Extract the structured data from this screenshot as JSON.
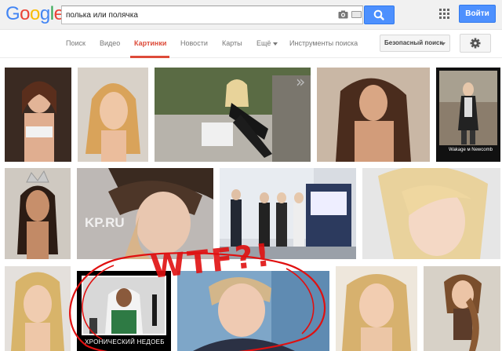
{
  "header": {
    "logo_text": "Google",
    "logo_colors": [
      "#4285f4",
      "#ea4335",
      "#fbbc05",
      "#4285f4",
      "#34a853",
      "#ea4335"
    ],
    "search_value": "полька или полячка",
    "search_button_icon": "search-icon",
    "apps_icon": "apps-grid-icon",
    "signin_label": "Войти",
    "accent_color": "#4d90fe"
  },
  "nav": {
    "tabs": [
      {
        "label": "Поиск",
        "active": false
      },
      {
        "label": "Видео",
        "active": false
      },
      {
        "label": "Картинки",
        "active": true
      },
      {
        "label": "Новости",
        "active": false
      },
      {
        "label": "Карты",
        "active": false
      },
      {
        "label": "Ещё",
        "active": false
      },
      {
        "label": "Инструменты поиска",
        "active": false
      }
    ],
    "safe_search_label": "Безопасный поиск",
    "settings_icon": "gear-icon",
    "active_color": "#dd4b39"
  },
  "results": {
    "captions": {
      "wakage": "Wakage м Newcomb",
      "kp": "KP.RU",
      "meme": "ХРОНИЧЕСКИЙ НЕДОЕБ"
    },
    "annotation_text": "WTF?!"
  }
}
